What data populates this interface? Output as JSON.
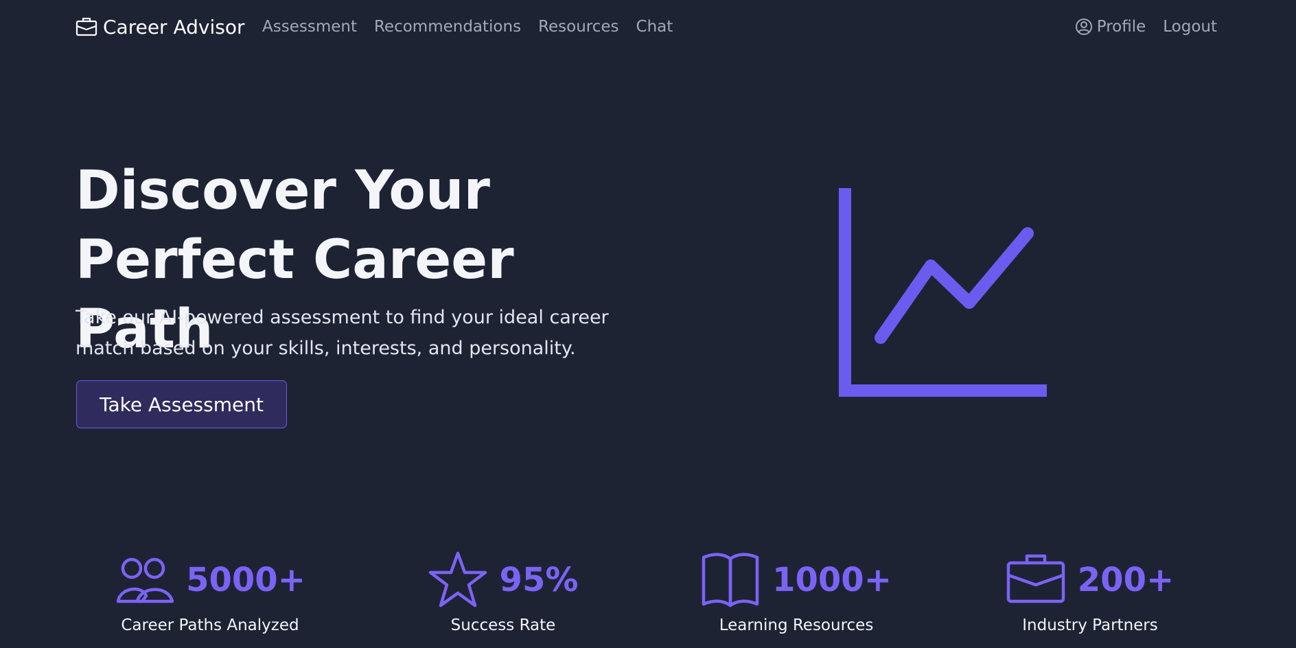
{
  "nav": {
    "brand": "Career Advisor",
    "links": [
      "Assessment",
      "Recommendations",
      "Resources",
      "Chat"
    ],
    "profile": "Profile",
    "logout": "Logout"
  },
  "hero": {
    "title_line1": "Discover Your",
    "title_line2": "Perfect Career Path",
    "subtitle_line1": "Take our AI-powered assessment to find your ideal career",
    "subtitle_line2": "match based on your skills, interests, and personality.",
    "cta": "Take Assessment",
    "illustration_icon": "line-chart-icon"
  },
  "stats": [
    {
      "icon": "people-icon",
      "value": "5000+",
      "label": "Career Paths Analyzed"
    },
    {
      "icon": "star-icon",
      "value": "95%",
      "label": "Success Rate"
    },
    {
      "icon": "book-icon",
      "value": "1000+",
      "label": "Learning Resources"
    },
    {
      "icon": "briefcase-icon",
      "value": "200+",
      "label": "Industry Partners"
    }
  ],
  "colors": {
    "background": "#1e2334",
    "accent": "#6b5cf0",
    "stat_value": "#7b63f5",
    "nav_muted": "#a4a8b7",
    "cta_bg": "#2f2b5c"
  }
}
